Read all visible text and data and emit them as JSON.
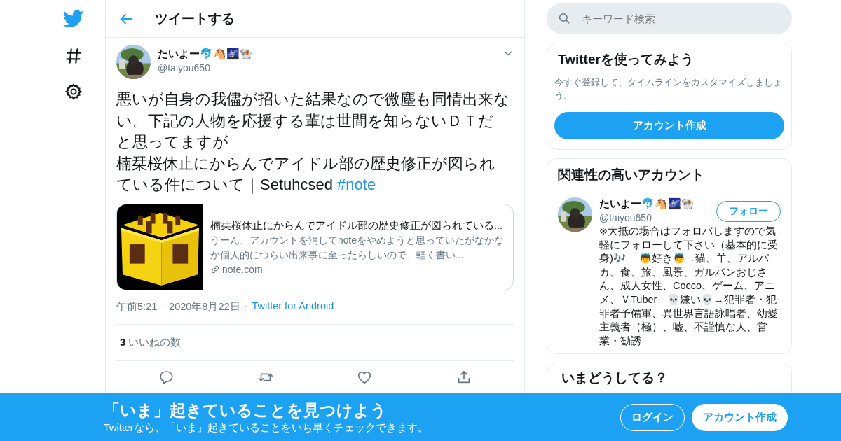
{
  "nav": {
    "items": [
      {
        "kind": "logo"
      },
      {
        "kind": "explore"
      },
      {
        "kind": "settings"
      }
    ]
  },
  "header": {
    "title": "ツイートする"
  },
  "tweet": {
    "author": {
      "name": "たいよー🐬🐴🌌🐏",
      "handle": "@taiyou650"
    },
    "text": [
      "悪いが自身の我儘が招いた結果なので微塵も同情出来ない。下記の人物を応援する輩は世間を知らないＤＴだと思ってますが",
      "楠栞桜休止にからんでアイドル部の歴史修正が図られている件について｜Setuhcsed "
    ],
    "hashtag": "#note",
    "card": {
      "title": "楠栞桜休止にからんでアイドル部の歴史修正が図られている...",
      "description": "うーん、アカウントを消してnoteをやめようと思っていたがなかなか個人的につらい出来事に至ったらしいので、軽く書い...",
      "domain": "note.com"
    },
    "time": "午前5:21",
    "separator": "·",
    "date": "2020年8月22日",
    "source": "Twitter for Android",
    "likes": {
      "count": "3",
      "label": "いいねの数"
    },
    "actions": [
      {
        "kind": "reply"
      },
      {
        "kind": "retweet"
      },
      {
        "kind": "like"
      },
      {
        "kind": "share"
      }
    ]
  },
  "search": {
    "placeholder": "キーワード検索"
  },
  "signup_card": {
    "title": "Twitterを使ってみよう",
    "text": "今すぐ登録して、タイムラインをカスタマイズしましょう。",
    "button": "アカウント作成"
  },
  "related": {
    "title": "関連性の高いアカウント",
    "accounts": [
      {
        "name": "たいよー🐬🐴🌌🐏",
        "handle": "@taiyou650",
        "follow": "フォロー",
        "bio": "※大抵の場合はフォロバしますので気軽にフォローして下さい（基本的に受身)🎶　 👼好き👼→猫、羊、アルパカ、食、旅、風景、ガルパンおじさん、成人女性、Cocco、ゲーム、アニメ、ＶTuber　💀嫌い💀→犯罪者・犯罪者予備軍、異世界言語詠唱者、幼愛主義者（極）、嘘、不謹慎な人、営業・勧誘"
      }
    ]
  },
  "trends": {
    "title": "いまどうしてる？"
  },
  "banner": {
    "title": "「いま」起きていることを見つけよう",
    "subtitle": "Twitterなら、「いま」起きていることをいち早くチェックできます。",
    "login": "ログイン",
    "signup": "アカウント作成"
  }
}
